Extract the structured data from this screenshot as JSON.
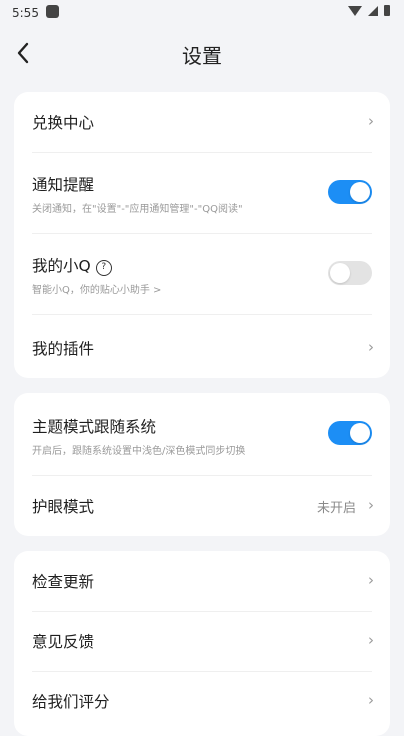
{
  "status": {
    "time": "5:55"
  },
  "header": {
    "title": "设置"
  },
  "card1": {
    "exchange": {
      "label": "兑换中心"
    },
    "notify": {
      "label": "通知提醒",
      "sub": "关闭通知，在\"设置\"-\"应用通知管理\"-\"QQ阅读\"",
      "on": true
    },
    "xiaoq": {
      "label": "我的小Q",
      "sub": "智能小Q，你的贴心小助手 >",
      "on": false
    },
    "plugins": {
      "label": "我的插件"
    }
  },
  "card2": {
    "theme": {
      "label": "主题模式跟随系统",
      "sub": "开启后，跟随系统设置中浅色/深色模式同步切换",
      "on": true
    },
    "eye": {
      "label": "护眼模式",
      "value": "未开启"
    }
  },
  "card3": {
    "update": {
      "label": "检查更新"
    },
    "feedback": {
      "label": "意见反馈"
    },
    "rate": {
      "label": "给我们评分"
    }
  },
  "colors": {
    "accent": "#1c8ef5",
    "background": "#f3f4f7"
  }
}
